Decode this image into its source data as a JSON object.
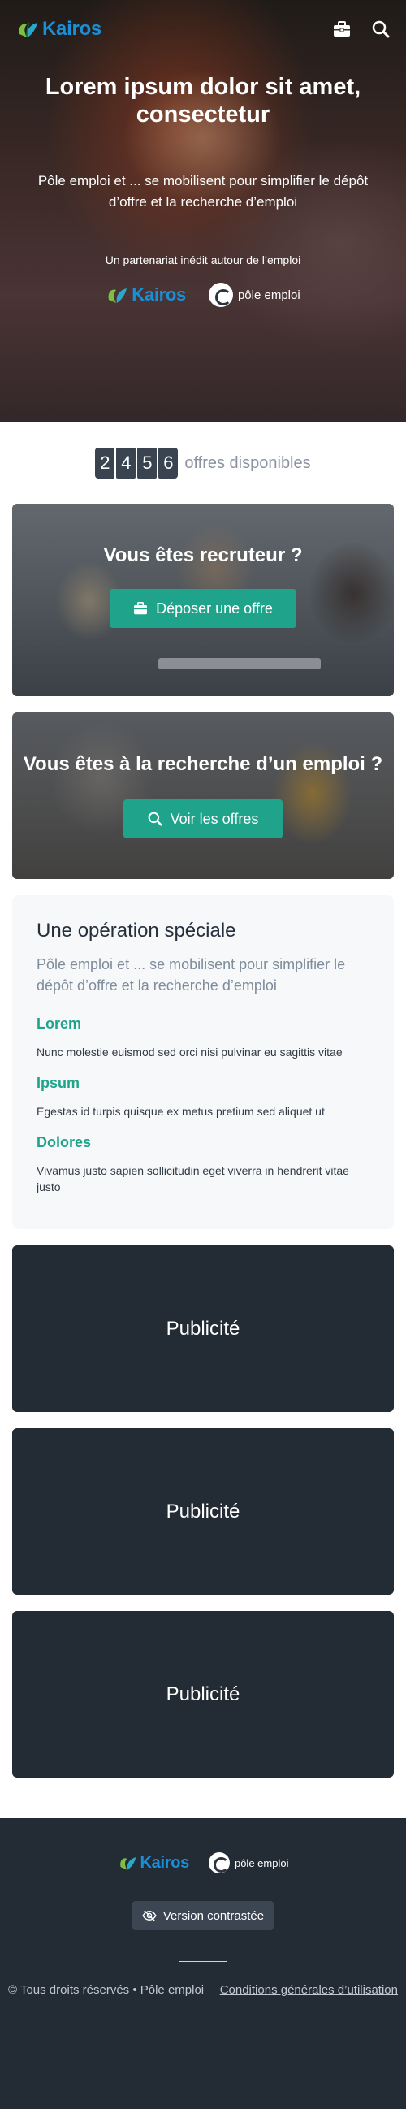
{
  "header": {
    "brand": "Kairos",
    "icons": [
      "briefcase-icon",
      "search-icon"
    ]
  },
  "hero": {
    "title": "Lorem ipsum dolor sit amet, consectetur",
    "subtitle": "Pôle emploi et ... se mobilisent pour simplifier le dépôt d’offre et la recherche d’emploi",
    "partnership": "Un partenariat inédit autour de l’emploi",
    "partner_logo_text": "Kairos",
    "pe_logo_text": "pôle emploi"
  },
  "counter": {
    "digits": [
      "2",
      "4",
      "5",
      "6"
    ],
    "label": "offres disponibles"
  },
  "recruiter_card": {
    "title": "Vous êtes recruteur ?",
    "button": "Déposer une offre"
  },
  "job_card": {
    "title": "Vous êtes à la recherche d’un emploi ?",
    "button": "Voir les offres"
  },
  "special": {
    "title": "Une opération spéciale",
    "lead": "Pôle emploi et ... se mobilisent pour simplifier le dépôt d’offre et la recherche d’emploi",
    "features": [
      {
        "title": "Lorem",
        "text": "Nunc molestie euismod sed orci nisi pulvinar eu sagittis vitae"
      },
      {
        "title": "Ipsum",
        "text": "Egestas id turpis quisque ex metus pretium sed aliquet ut"
      },
      {
        "title": "Dolores",
        "text": "Vivamus justo sapien sollicitudin eget viverra in hendrerit vitae justo"
      }
    ]
  },
  "ads": [
    "Publicité",
    "Publicité",
    "Publicité"
  ],
  "footer": {
    "brand": "Kairos",
    "pe_logo_text": "pôle emploi",
    "contrast_button": "Version contrastée",
    "copyright": "© Tous droits réservés • Pôle emploi",
    "terms_link": "Conditions générales d’utilisation"
  },
  "colors": {
    "accent_green": "#1fa38a",
    "brand_blue": "#1a8fd6",
    "dark_panel": "#232b35"
  }
}
